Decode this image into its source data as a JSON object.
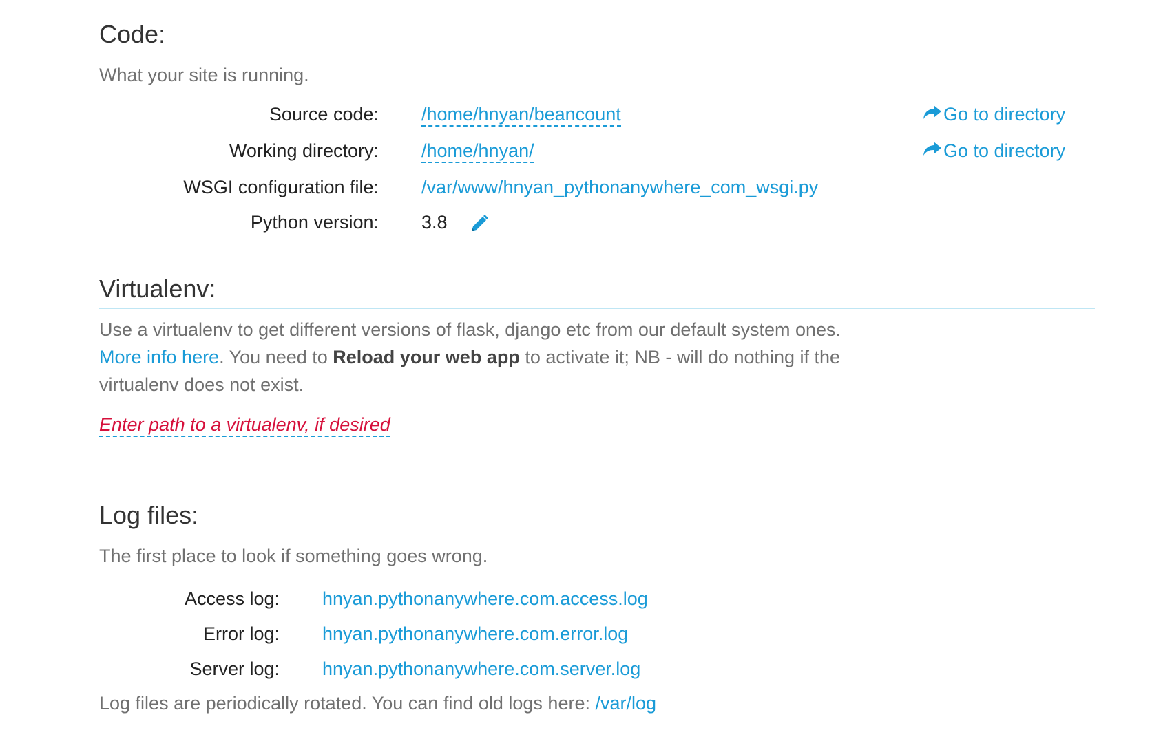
{
  "code": {
    "title": "Code:",
    "subtitle": "What your site is running.",
    "source_label": "Source code:",
    "source_value": "/home/hnyan/beancount",
    "working_label": "Working directory:",
    "working_value": "/home/hnyan/",
    "wsgi_label": "WSGI configuration file:",
    "wsgi_value": "/var/www/hnyan_pythonanywhere_com_wsgi.py",
    "python_label": "Python version:",
    "python_value": "3.8",
    "goto_label": "Go to directory",
    "goto_icon": "share-arrow-icon",
    "edit_icon": "pencil-icon"
  },
  "virtualenv": {
    "title": "Virtualenv:",
    "text_1": "Use a virtualenv to get different versions of flask, django etc from our default system ones.",
    "more_info_link": "More info here",
    "text_2": ". You need to",
    "reload_bold": "Reload your web app",
    "text_3": "to activate it; NB - will do nothing if the virtualenv does not exist.",
    "path_placeholder": "Enter path to a virtualenv, if desired"
  },
  "logs": {
    "title": "Log files:",
    "subtitle": "The first place to look if something goes wrong.",
    "access_label": "Access log:",
    "access_value": "hnyan.pythonanywhere.com.access.log",
    "error_label": "Error log:",
    "error_value": "hnyan.pythonanywhere.com.error.log",
    "server_label": "Server log:",
    "server_value": "hnyan.pythonanywhere.com.server.log",
    "footer_text": "Log files are periodically rotated. You can find old logs here:",
    "footer_link": "/var/log"
  },
  "colors": {
    "link": "#1a9bd7",
    "placeholder_red": "#d6103b",
    "rule": "#bfe6f4",
    "muted_text": "#707070"
  }
}
